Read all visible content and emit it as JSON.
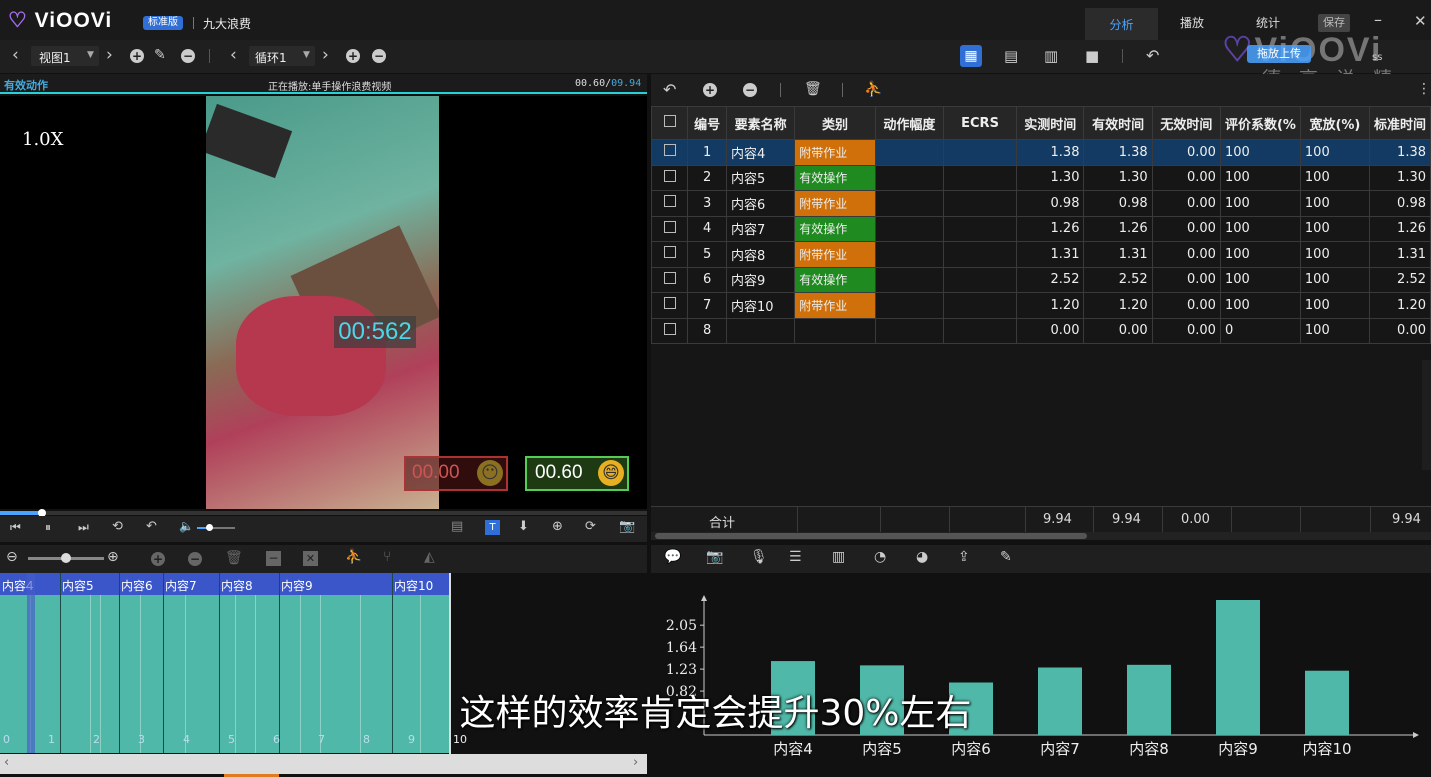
{
  "app": {
    "name": "ViOOVi",
    "edition": "标准版",
    "doc_title": "九大浪费"
  },
  "tabs": [
    {
      "label": "分析"
    },
    {
      "label": "播放"
    },
    {
      "label": "统计"
    }
  ],
  "save_label": "保存",
  "toolbar2": {
    "view": "视图1",
    "loop": "循环1"
  },
  "watermark": {
    "logo": "ViOOVi",
    "subtitle": "德 高 说 精 益",
    "upload": "拖放上传",
    "side": "ss"
  },
  "video": {
    "label": "有效动作",
    "playing": "正在播放:单手操作浪费视频",
    "time_current": "00.60/",
    "time_total": "09.94",
    "speed": "1.0X",
    "overlay_timer": "00:562",
    "badge_invalid": "00.00",
    "badge_valid": "00.60",
    "progress": 0.065
  },
  "table": {
    "headers": [
      "编号",
      "要素名称",
      "类别",
      "动作幅度",
      "ECRS",
      "实测时间",
      "有效时间",
      "无效时间",
      "评价系数(%",
      "宽放(%)",
      "标准时间"
    ],
    "rows": [
      {
        "no": "1",
        "name": "内容4",
        "cat": "附带作业",
        "cat_color": "#d0700a",
        "measured": "1.38",
        "effective": "1.38",
        "invalid": "0.00",
        "rating": "100",
        "allow": "100",
        "std": "1.38"
      },
      {
        "no": "2",
        "name": "内容5",
        "cat": "有效操作",
        "cat_color": "#1f8a1f",
        "measured": "1.30",
        "effective": "1.30",
        "invalid": "0.00",
        "rating": "100",
        "allow": "100",
        "std": "1.30"
      },
      {
        "no": "3",
        "name": "内容6",
        "cat": "附带作业",
        "cat_color": "#d0700a",
        "measured": "0.98",
        "effective": "0.98",
        "invalid": "0.00",
        "rating": "100",
        "allow": "100",
        "std": "0.98"
      },
      {
        "no": "4",
        "name": "内容7",
        "cat": "有效操作",
        "cat_color": "#1f8a1f",
        "measured": "1.26",
        "effective": "1.26",
        "invalid": "0.00",
        "rating": "100",
        "allow": "100",
        "std": "1.26"
      },
      {
        "no": "5",
        "name": "内容8",
        "cat": "附带作业",
        "cat_color": "#d0700a",
        "measured": "1.31",
        "effective": "1.31",
        "invalid": "0.00",
        "rating": "100",
        "allow": "100",
        "std": "1.31"
      },
      {
        "no": "6",
        "name": "内容9",
        "cat": "有效操作",
        "cat_color": "#1f8a1f",
        "measured": "2.52",
        "effective": "2.52",
        "invalid": "0.00",
        "rating": "100",
        "allow": "100",
        "std": "2.52"
      },
      {
        "no": "7",
        "name": "内容10",
        "cat": "附带作业",
        "cat_color": "#d0700a",
        "measured": "1.20",
        "effective": "1.20",
        "invalid": "0.00",
        "rating": "100",
        "allow": "100",
        "std": "1.20"
      },
      {
        "no": "8",
        "name": "",
        "cat": "",
        "cat_color": "",
        "measured": "0.00",
        "effective": "0.00",
        "invalid": "0.00",
        "rating": "0",
        "allow": "100",
        "std": "0.00"
      }
    ],
    "total": {
      "label": "合计",
      "measured": "9.94",
      "effective": "9.94",
      "invalid": "0.00",
      "std": "9.94"
    }
  },
  "timeline": {
    "segments": [
      "内容4",
      "内容5",
      "内容6",
      "内容7",
      "内容8",
      "内容9",
      "内容10"
    ],
    "ticks": [
      "0",
      "1",
      "2",
      "3",
      "4",
      "5",
      "6",
      "7",
      "8",
      "9",
      "10"
    ]
  },
  "chart_data": {
    "type": "bar",
    "categories": [
      "内容4",
      "内容5",
      "内容6",
      "内容7",
      "内容8",
      "内容9",
      "内容10"
    ],
    "values": [
      1.38,
      1.3,
      0.98,
      1.26,
      1.31,
      2.52,
      1.2
    ],
    "yticks": [
      "2.05",
      "1.64",
      "1.23",
      "0.82"
    ],
    "bar_color": "#4fb8a8"
  },
  "subtitle": "这样的效率肯定会提升30%左右"
}
